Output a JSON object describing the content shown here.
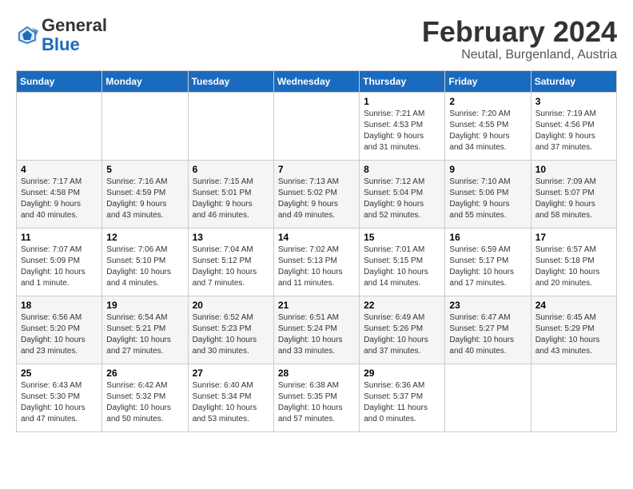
{
  "header": {
    "logo_general": "General",
    "logo_blue": "Blue",
    "month_title": "February 2024",
    "location": "Neutal, Burgenland, Austria"
  },
  "calendar": {
    "days_of_week": [
      "Sunday",
      "Monday",
      "Tuesday",
      "Wednesday",
      "Thursday",
      "Friday",
      "Saturday"
    ],
    "weeks": [
      [
        {
          "day": "",
          "info": ""
        },
        {
          "day": "",
          "info": ""
        },
        {
          "day": "",
          "info": ""
        },
        {
          "day": "",
          "info": ""
        },
        {
          "day": "1",
          "info": "Sunrise: 7:21 AM\nSunset: 4:53 PM\nDaylight: 9 hours\nand 31 minutes."
        },
        {
          "day": "2",
          "info": "Sunrise: 7:20 AM\nSunset: 4:55 PM\nDaylight: 9 hours\nand 34 minutes."
        },
        {
          "day": "3",
          "info": "Sunrise: 7:19 AM\nSunset: 4:56 PM\nDaylight: 9 hours\nand 37 minutes."
        }
      ],
      [
        {
          "day": "4",
          "info": "Sunrise: 7:17 AM\nSunset: 4:58 PM\nDaylight: 9 hours\nand 40 minutes."
        },
        {
          "day": "5",
          "info": "Sunrise: 7:16 AM\nSunset: 4:59 PM\nDaylight: 9 hours\nand 43 minutes."
        },
        {
          "day": "6",
          "info": "Sunrise: 7:15 AM\nSunset: 5:01 PM\nDaylight: 9 hours\nand 46 minutes."
        },
        {
          "day": "7",
          "info": "Sunrise: 7:13 AM\nSunset: 5:02 PM\nDaylight: 9 hours\nand 49 minutes."
        },
        {
          "day": "8",
          "info": "Sunrise: 7:12 AM\nSunset: 5:04 PM\nDaylight: 9 hours\nand 52 minutes."
        },
        {
          "day": "9",
          "info": "Sunrise: 7:10 AM\nSunset: 5:06 PM\nDaylight: 9 hours\nand 55 minutes."
        },
        {
          "day": "10",
          "info": "Sunrise: 7:09 AM\nSunset: 5:07 PM\nDaylight: 9 hours\nand 58 minutes."
        }
      ],
      [
        {
          "day": "11",
          "info": "Sunrise: 7:07 AM\nSunset: 5:09 PM\nDaylight: 10 hours\nand 1 minute."
        },
        {
          "day": "12",
          "info": "Sunrise: 7:06 AM\nSunset: 5:10 PM\nDaylight: 10 hours\nand 4 minutes."
        },
        {
          "day": "13",
          "info": "Sunrise: 7:04 AM\nSunset: 5:12 PM\nDaylight: 10 hours\nand 7 minutes."
        },
        {
          "day": "14",
          "info": "Sunrise: 7:02 AM\nSunset: 5:13 PM\nDaylight: 10 hours\nand 11 minutes."
        },
        {
          "day": "15",
          "info": "Sunrise: 7:01 AM\nSunset: 5:15 PM\nDaylight: 10 hours\nand 14 minutes."
        },
        {
          "day": "16",
          "info": "Sunrise: 6:59 AM\nSunset: 5:17 PM\nDaylight: 10 hours\nand 17 minutes."
        },
        {
          "day": "17",
          "info": "Sunrise: 6:57 AM\nSunset: 5:18 PM\nDaylight: 10 hours\nand 20 minutes."
        }
      ],
      [
        {
          "day": "18",
          "info": "Sunrise: 6:56 AM\nSunset: 5:20 PM\nDaylight: 10 hours\nand 23 minutes."
        },
        {
          "day": "19",
          "info": "Sunrise: 6:54 AM\nSunset: 5:21 PM\nDaylight: 10 hours\nand 27 minutes."
        },
        {
          "day": "20",
          "info": "Sunrise: 6:52 AM\nSunset: 5:23 PM\nDaylight: 10 hours\nand 30 minutes."
        },
        {
          "day": "21",
          "info": "Sunrise: 6:51 AM\nSunset: 5:24 PM\nDaylight: 10 hours\nand 33 minutes."
        },
        {
          "day": "22",
          "info": "Sunrise: 6:49 AM\nSunset: 5:26 PM\nDaylight: 10 hours\nand 37 minutes."
        },
        {
          "day": "23",
          "info": "Sunrise: 6:47 AM\nSunset: 5:27 PM\nDaylight: 10 hours\nand 40 minutes."
        },
        {
          "day": "24",
          "info": "Sunrise: 6:45 AM\nSunset: 5:29 PM\nDaylight: 10 hours\nand 43 minutes."
        }
      ],
      [
        {
          "day": "25",
          "info": "Sunrise: 6:43 AM\nSunset: 5:30 PM\nDaylight: 10 hours\nand 47 minutes."
        },
        {
          "day": "26",
          "info": "Sunrise: 6:42 AM\nSunset: 5:32 PM\nDaylight: 10 hours\nand 50 minutes."
        },
        {
          "day": "27",
          "info": "Sunrise: 6:40 AM\nSunset: 5:34 PM\nDaylight: 10 hours\nand 53 minutes."
        },
        {
          "day": "28",
          "info": "Sunrise: 6:38 AM\nSunset: 5:35 PM\nDaylight: 10 hours\nand 57 minutes."
        },
        {
          "day": "29",
          "info": "Sunrise: 6:36 AM\nSunset: 5:37 PM\nDaylight: 11 hours\nand 0 minutes."
        },
        {
          "day": "",
          "info": ""
        },
        {
          "day": "",
          "info": ""
        }
      ]
    ]
  }
}
